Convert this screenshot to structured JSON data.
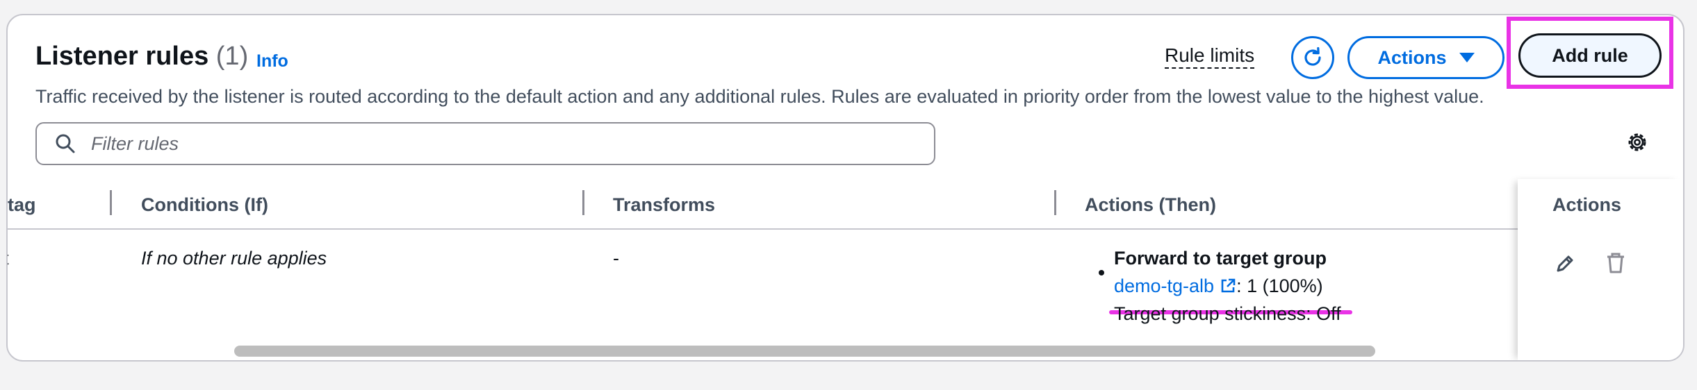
{
  "header": {
    "title": "Listener rules",
    "count": "(1)",
    "info": "Info",
    "description": "Traffic received by the listener is routed according to the default action and any additional rules. Rules are evaluated in priority order from the lowest value to the highest value.",
    "rule_limits": "Rule limits",
    "actions_label": "Actions",
    "add_rule_label": "Add rule"
  },
  "filter": {
    "placeholder": "Filter rules"
  },
  "table": {
    "columns": [
      "tag",
      "Conditions (If)",
      "Transforms",
      "Actions (Then)",
      "Actions"
    ],
    "rows": [
      {
        "tag_fragment": "t",
        "conditions": "If no other rule applies",
        "transforms": "-",
        "action_title": "Forward to target group",
        "target_group": "demo-tg-alb",
        "target_weight": ": 1 (100%)",
        "stickiness": "Target group stickiness: Off"
      }
    ]
  },
  "icons": {
    "refresh": "refresh-icon",
    "search": "search-icon",
    "settings": "gear-icon",
    "edit": "pencil-icon",
    "delete": "trash-icon",
    "external": "external-link-icon"
  },
  "colors": {
    "primary": "#006ce0",
    "highlight": "#e933e6",
    "text": "#0f141a",
    "muted": "#414d5c"
  }
}
